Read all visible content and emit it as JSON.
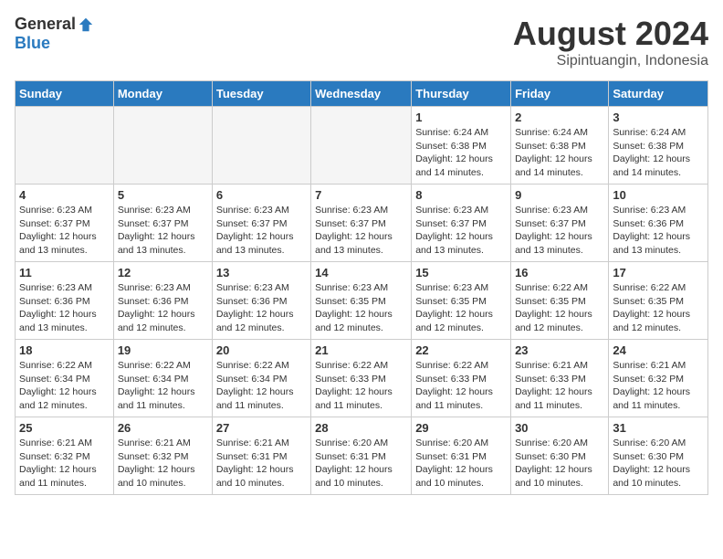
{
  "header": {
    "logo_general": "General",
    "logo_blue": "Blue",
    "month_year": "August 2024",
    "location": "Sipintuangin, Indonesia"
  },
  "weekdays": [
    "Sunday",
    "Monday",
    "Tuesday",
    "Wednesday",
    "Thursday",
    "Friday",
    "Saturday"
  ],
  "weeks": [
    [
      {
        "day": "",
        "info": ""
      },
      {
        "day": "",
        "info": ""
      },
      {
        "day": "",
        "info": ""
      },
      {
        "day": "",
        "info": ""
      },
      {
        "day": "1",
        "info": "Sunrise: 6:24 AM\nSunset: 6:38 PM\nDaylight: 12 hours\nand 14 minutes."
      },
      {
        "day": "2",
        "info": "Sunrise: 6:24 AM\nSunset: 6:38 PM\nDaylight: 12 hours\nand 14 minutes."
      },
      {
        "day": "3",
        "info": "Sunrise: 6:24 AM\nSunset: 6:38 PM\nDaylight: 12 hours\nand 14 minutes."
      }
    ],
    [
      {
        "day": "4",
        "info": "Sunrise: 6:23 AM\nSunset: 6:37 PM\nDaylight: 12 hours\nand 13 minutes."
      },
      {
        "day": "5",
        "info": "Sunrise: 6:23 AM\nSunset: 6:37 PM\nDaylight: 12 hours\nand 13 minutes."
      },
      {
        "day": "6",
        "info": "Sunrise: 6:23 AM\nSunset: 6:37 PM\nDaylight: 12 hours\nand 13 minutes."
      },
      {
        "day": "7",
        "info": "Sunrise: 6:23 AM\nSunset: 6:37 PM\nDaylight: 12 hours\nand 13 minutes."
      },
      {
        "day": "8",
        "info": "Sunrise: 6:23 AM\nSunset: 6:37 PM\nDaylight: 12 hours\nand 13 minutes."
      },
      {
        "day": "9",
        "info": "Sunrise: 6:23 AM\nSunset: 6:37 PM\nDaylight: 12 hours\nand 13 minutes."
      },
      {
        "day": "10",
        "info": "Sunrise: 6:23 AM\nSunset: 6:36 PM\nDaylight: 12 hours\nand 13 minutes."
      }
    ],
    [
      {
        "day": "11",
        "info": "Sunrise: 6:23 AM\nSunset: 6:36 PM\nDaylight: 12 hours\nand 13 minutes."
      },
      {
        "day": "12",
        "info": "Sunrise: 6:23 AM\nSunset: 6:36 PM\nDaylight: 12 hours\nand 12 minutes."
      },
      {
        "day": "13",
        "info": "Sunrise: 6:23 AM\nSunset: 6:36 PM\nDaylight: 12 hours\nand 12 minutes."
      },
      {
        "day": "14",
        "info": "Sunrise: 6:23 AM\nSunset: 6:35 PM\nDaylight: 12 hours\nand 12 minutes."
      },
      {
        "day": "15",
        "info": "Sunrise: 6:23 AM\nSunset: 6:35 PM\nDaylight: 12 hours\nand 12 minutes."
      },
      {
        "day": "16",
        "info": "Sunrise: 6:22 AM\nSunset: 6:35 PM\nDaylight: 12 hours\nand 12 minutes."
      },
      {
        "day": "17",
        "info": "Sunrise: 6:22 AM\nSunset: 6:35 PM\nDaylight: 12 hours\nand 12 minutes."
      }
    ],
    [
      {
        "day": "18",
        "info": "Sunrise: 6:22 AM\nSunset: 6:34 PM\nDaylight: 12 hours\nand 12 minutes."
      },
      {
        "day": "19",
        "info": "Sunrise: 6:22 AM\nSunset: 6:34 PM\nDaylight: 12 hours\nand 11 minutes."
      },
      {
        "day": "20",
        "info": "Sunrise: 6:22 AM\nSunset: 6:34 PM\nDaylight: 12 hours\nand 11 minutes."
      },
      {
        "day": "21",
        "info": "Sunrise: 6:22 AM\nSunset: 6:33 PM\nDaylight: 12 hours\nand 11 minutes."
      },
      {
        "day": "22",
        "info": "Sunrise: 6:22 AM\nSunset: 6:33 PM\nDaylight: 12 hours\nand 11 minutes."
      },
      {
        "day": "23",
        "info": "Sunrise: 6:21 AM\nSunset: 6:33 PM\nDaylight: 12 hours\nand 11 minutes."
      },
      {
        "day": "24",
        "info": "Sunrise: 6:21 AM\nSunset: 6:32 PM\nDaylight: 12 hours\nand 11 minutes."
      }
    ],
    [
      {
        "day": "25",
        "info": "Sunrise: 6:21 AM\nSunset: 6:32 PM\nDaylight: 12 hours\nand 11 minutes."
      },
      {
        "day": "26",
        "info": "Sunrise: 6:21 AM\nSunset: 6:32 PM\nDaylight: 12 hours\nand 10 minutes."
      },
      {
        "day": "27",
        "info": "Sunrise: 6:21 AM\nSunset: 6:31 PM\nDaylight: 12 hours\nand 10 minutes."
      },
      {
        "day": "28",
        "info": "Sunrise: 6:20 AM\nSunset: 6:31 PM\nDaylight: 12 hours\nand 10 minutes."
      },
      {
        "day": "29",
        "info": "Sunrise: 6:20 AM\nSunset: 6:31 PM\nDaylight: 12 hours\nand 10 minutes."
      },
      {
        "day": "30",
        "info": "Sunrise: 6:20 AM\nSunset: 6:30 PM\nDaylight: 12 hours\nand 10 minutes."
      },
      {
        "day": "31",
        "info": "Sunrise: 6:20 AM\nSunset: 6:30 PM\nDaylight: 12 hours\nand 10 minutes."
      }
    ]
  ]
}
